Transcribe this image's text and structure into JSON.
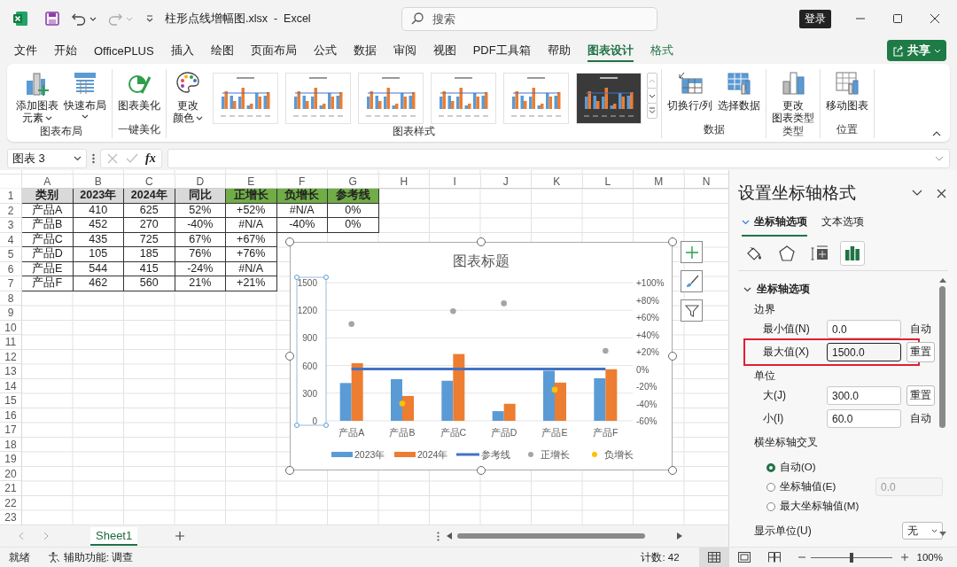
{
  "title_bar": {
    "file_title": "柱形点线增幅图.xlsx  -  Excel",
    "search": {
      "placeholder": "搜索"
    },
    "sign_in": "登录"
  },
  "menu_tabs": [
    {
      "label": "文件",
      "selected": false,
      "contextual": false
    },
    {
      "label": "开始",
      "selected": false,
      "contextual": false
    },
    {
      "label": "OfficePLUS",
      "selected": false,
      "contextual": false
    },
    {
      "label": "插入",
      "selected": false,
      "contextual": false
    },
    {
      "label": "绘图",
      "selected": false,
      "contextual": false
    },
    {
      "label": "页面布局",
      "selected": false,
      "contextual": false
    },
    {
      "label": "公式",
      "selected": false,
      "contextual": false
    },
    {
      "label": "数据",
      "selected": false,
      "contextual": false
    },
    {
      "label": "审阅",
      "selected": false,
      "contextual": false
    },
    {
      "label": "视图",
      "selected": false,
      "contextual": false
    },
    {
      "label": "PDF工具箱",
      "selected": false,
      "contextual": false
    },
    {
      "label": "帮助",
      "selected": false,
      "contextual": false
    },
    {
      "label": "图表设计",
      "selected": true,
      "contextual": true
    },
    {
      "label": "格式",
      "selected": false,
      "contextual": true
    }
  ],
  "share_button": "共享",
  "ribbon": {
    "groups": [
      {
        "label": "图表布局",
        "buttons": [
          {
            "kind": "add-element",
            "lines": [
              "添加图表",
              "元素"
            ],
            "dropdown": true
          },
          {
            "kind": "quick-layout",
            "lines": [
              "快速布局"
            ],
            "dropdown": true
          }
        ]
      },
      {
        "label": "一键美化",
        "buttons": [
          {
            "kind": "beautify",
            "lines": [
              "图表美化"
            ],
            "dropdown": false
          }
        ]
      },
      {
        "label": "图表样式",
        "buttons": [
          {
            "kind": "palette",
            "lines": [
              "更改",
              "颜色"
            ],
            "dropdown": true
          }
        ],
        "gallery": [
          {
            "kind": "light"
          },
          {
            "kind": "light"
          },
          {
            "kind": "light"
          },
          {
            "kind": "light"
          },
          {
            "kind": "light"
          },
          {
            "kind": "dark"
          }
        ]
      },
      {
        "label": "数据",
        "buttons": [
          {
            "kind": "switch",
            "lines": [
              "切换行/列"
            ],
            "dropdown": false
          },
          {
            "kind": "select-data",
            "lines": [
              "选择数据"
            ],
            "dropdown": false
          }
        ]
      },
      {
        "label": "类型",
        "buttons": [
          {
            "kind": "change-type",
            "lines": [
              "更改",
              "图表类型"
            ],
            "dropdown": false
          }
        ]
      },
      {
        "label": "位置",
        "buttons": [
          {
            "kind": "move",
            "lines": [
              "移动图表"
            ],
            "dropdown": false
          }
        ]
      }
    ]
  },
  "formula_bar": {
    "name_box": "图表 3",
    "function_label": "fx"
  },
  "sheet": {
    "columns": [
      "A",
      "B",
      "C",
      "D",
      "E",
      "F",
      "G",
      "H",
      "I",
      "J",
      "K",
      "L",
      "M",
      "N"
    ],
    "rows": [
      {
        "num": "1",
        "cells": [
          {
            "text": "类别",
            "color": "#d9d9d9"
          },
          {
            "text": "2023年",
            "color": "#d9d9d9"
          },
          {
            "text": "2024年",
            "color": "#d9d9d9"
          },
          {
            "text": "同比",
            "color": "#d9d9d9"
          },
          {
            "text": "正增长",
            "color": "#70ad47"
          },
          {
            "text": "负增长",
            "color": "#70ad47"
          },
          {
            "text": "参考线",
            "color": "#70ad47"
          }
        ]
      },
      {
        "num": "2",
        "cells": [
          "产品A",
          "410",
          "625",
          "52%",
          "+52%",
          "#N/A",
          "0%"
        ]
      },
      {
        "num": "3",
        "cells": [
          "产品B",
          "452",
          "270",
          "-40%",
          "#N/A",
          "-40%",
          "0%"
        ]
      },
      {
        "num": "4",
        "cells": [
          "产品C",
          "435",
          "725",
          "67%",
          "+67%"
        ]
      },
      {
        "num": "5",
        "cells": [
          "产品D",
          "105",
          "185",
          "76%",
          "+76%"
        ]
      },
      {
        "num": "6",
        "cells": [
          "产品E",
          "544",
          "415",
          "-24%",
          "#N/A"
        ]
      },
      {
        "num": "7",
        "cells": [
          "产品F",
          "462",
          "560",
          "21%",
          "+21%"
        ]
      },
      {
        "num": "8"
      },
      {
        "num": "9"
      },
      {
        "num": "10"
      },
      {
        "num": "11"
      },
      {
        "num": "12"
      },
      {
        "num": "13"
      },
      {
        "num": "14"
      },
      {
        "num": "15"
      },
      {
        "num": "16"
      },
      {
        "num": "17"
      },
      {
        "num": "18"
      },
      {
        "num": "19"
      },
      {
        "num": "20"
      },
      {
        "num": "21"
      },
      {
        "num": "22"
      },
      {
        "num": "23"
      }
    ]
  },
  "chart": {
    "selected": true,
    "chart_data": {
      "type": "bar",
      "title": "图表标题",
      "categories": [
        "产品A",
        "产品B",
        "产品C",
        "产品D",
        "产品E",
        "产品F"
      ],
      "series": [
        {
          "name": "2023年",
          "color": "#5b9bd5",
          "values": [
            410,
            452,
            435,
            105,
            544,
            462
          ]
        },
        {
          "name": "2024年",
          "color": "#ed7d31",
          "values": [
            625,
            270,
            725,
            185,
            415,
            560
          ]
        },
        {
          "name": "参考线",
          "color": "#4472c4",
          "type": "line",
          "axis": "y2",
          "values": [
            0,
            0,
            0,
            0,
            0,
            0
          ]
        },
        {
          "name": "正增长",
          "color": "#a5a5a5",
          "type": "scatter",
          "axis": "y2",
          "values": [
            0.52,
            null,
            0.67,
            0.76,
            null,
            0.21
          ]
        },
        {
          "name": "负增长",
          "color": "#ffc000",
          "type": "scatter",
          "axis": "y2",
          "values": [
            null,
            -0.4,
            null,
            null,
            -0.24,
            null
          ]
        }
      ],
      "grid": true,
      "legend": "bottom",
      "ylim": [
        0,
        1500
      ],
      "yticks": [
        0,
        300,
        600,
        900,
        1200,
        1500
      ],
      "y2lim": [
        -0.6,
        1.0
      ],
      "y2ticks": [
        {
          "value": -0.6,
          "label": "-60%"
        },
        {
          "value": -0.4,
          "label": "-40%"
        },
        {
          "value": -0.2,
          "label": "-20%"
        },
        {
          "value": 0,
          "label": "0%"
        },
        {
          "value": 0.2,
          "label": "+20%"
        },
        {
          "value": 0.4,
          "label": "+40%"
        },
        {
          "value": 0.6,
          "label": "+60%"
        },
        {
          "value": 0.8,
          "label": "+80%"
        },
        {
          "value": 1.0,
          "label": "+100%"
        }
      ]
    }
  },
  "chart_tools": [
    {
      "kind": "add"
    },
    {
      "kind": "style"
    },
    {
      "kind": "filter"
    }
  ],
  "sheet_tabs": [
    {
      "label": "Sheet1",
      "selected": true
    }
  ],
  "task_pane": {
    "title": "设置坐标轴格式",
    "tabs": [
      {
        "label": "坐标轴选项",
        "selected": true
      },
      {
        "label": "文本选项",
        "selected": false
      }
    ],
    "icon_tabs": [
      {
        "kind": "fill",
        "selected": false
      },
      {
        "kind": "effects",
        "selected": false
      },
      {
        "kind": "size",
        "selected": false
      },
      {
        "kind": "axis-options",
        "selected": true
      }
    ],
    "section": {
      "title": "坐标轴选项",
      "expanded": true,
      "bounds_heading": "边界",
      "bounds": [
        {
          "label": "最小值(N)",
          "value": "0.0",
          "action": "自动",
          "action_is_button": false,
          "focused": false,
          "highlighted": false
        },
        {
          "label": "最大值(X)",
          "value": "1500.0",
          "action": "重置",
          "action_is_button": true,
          "focused": true,
          "highlighted": true
        }
      ],
      "units_heading": "单位",
      "units": [
        {
          "label": "大(J)",
          "value": "300.0",
          "action": "重置",
          "action_is_button": true,
          "focused": false,
          "highlighted": false
        },
        {
          "label": "小(I)",
          "value": "60.0",
          "action": "自动",
          "action_is_button": false,
          "focused": false,
          "highlighted": false
        }
      ],
      "cross_heading": "横坐标轴交叉",
      "cross_options": [
        {
          "label": "自动(O)",
          "selected": true
        },
        {
          "label": "坐标轴值(E)",
          "selected": false,
          "field": {
            "value": "0.0",
            "disabled": true
          }
        },
        {
          "label": "最大坐标轴值(M)",
          "selected": false
        }
      ],
      "display_unit": {
        "label": "显示单位(U)",
        "value": "无"
      }
    }
  },
  "status_bar": {
    "ready": "就绪",
    "accessibility": "辅助功能: 调查",
    "count": "计数: 42",
    "views": [
      {
        "kind": "normal",
        "selected": true
      },
      {
        "kind": "page-layout",
        "selected": false
      },
      {
        "kind": "page-break",
        "selected": false
      }
    ],
    "zoom": {
      "level": 0.5,
      "reading": "100%"
    }
  }
}
